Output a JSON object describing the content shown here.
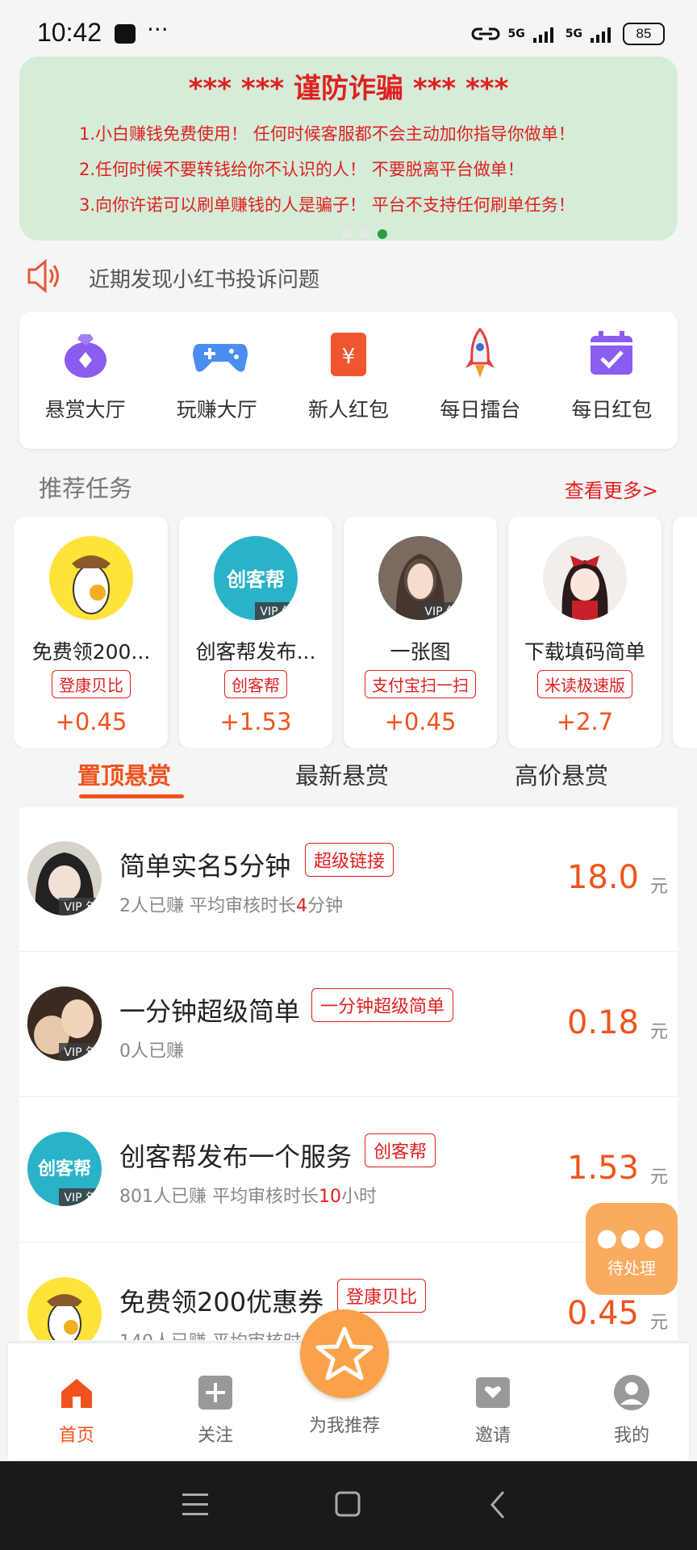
{
  "status_bar": {
    "time": "10:42",
    "more": "···",
    "net1": "5G",
    "net2": "5G",
    "battery": "85"
  },
  "banner": {
    "title": "***  ***  谨防诈骗  ***  ***",
    "lines": [
      "1.小白赚钱免费使用！ 任何时候客服都不会主动加你指导你做单！",
      "2.任何时候不要转钱给你不认识的人！ 不要脱离平台做单！",
      "3.向你许诺可以刷单赚钱的人是骗子！ 平台不支持任何刷单任务！"
    ]
  },
  "notice": {
    "text": "近期发现小红书投诉问题"
  },
  "quick_menu": [
    {
      "label": "悬赏大厅",
      "icon": "money-bag-icon",
      "color": "#8a5cf0"
    },
    {
      "label": "玩赚大厅",
      "icon": "gamepad-icon",
      "color": "#4a8ef0"
    },
    {
      "label": "新人红包",
      "icon": "red-envelope-icon",
      "color": "#f05530"
    },
    {
      "label": "每日擂台",
      "icon": "rocket-icon",
      "color": "#e04040"
    },
    {
      "label": "每日红包",
      "icon": "calendar-check-icon",
      "color": "#8a5cf0"
    }
  ],
  "recommend": {
    "title": "推荐任务",
    "see_more": "查看更多>",
    "cards": [
      {
        "title": "免费领200...",
        "tag": "登康贝比",
        "value": "+0.45",
        "vip": ""
      },
      {
        "title": "创客帮发布...",
        "tag": "创客帮",
        "value": "+1.53",
        "vip": "VIP 年",
        "avatar_text": "创客帮"
      },
      {
        "title": "一张图",
        "tag": "支付宝扫一扫",
        "value": "+0.45",
        "vip": "VIP 年"
      },
      {
        "title": "下载填码简单",
        "tag": "米读极速版",
        "value": "+2.7",
        "vip": ""
      }
    ]
  },
  "tabs": [
    "置顶悬赏",
    "最新悬赏",
    "高价悬赏"
  ],
  "list": [
    {
      "title": "简单实名5分钟",
      "tag": "超级链接",
      "sub_pre": "2人已赚  平均审核时长",
      "sub_num": "4",
      "sub_post": "分钟",
      "value": "18.0",
      "unit": "元",
      "vip": "VIP 年"
    },
    {
      "title": "一分钟超级简单",
      "tag": "一分钟超级简单",
      "sub_pre": "0人已赚",
      "sub_num": "",
      "sub_post": "",
      "value": "0.18",
      "unit": "元",
      "vip": "VIP 年"
    },
    {
      "title": "创客帮发布一个服务",
      "tag": "创客帮",
      "sub_pre": "801人已赚  平均审核时长",
      "sub_num": "10",
      "sub_post": "小时",
      "value": "1.53",
      "unit": "元",
      "vip": "VIP 年",
      "avatar_text": "创客帮"
    },
    {
      "title": "免费领200优惠券",
      "tag": "登康贝比",
      "sub_pre": "140人已赚  平均审核时",
      "sub_num": "",
      "sub_post": "",
      "value": "0.45",
      "unit": "元",
      "vip": ""
    }
  ],
  "pending": {
    "label": "待处理"
  },
  "bottom_nav": {
    "home": "首页",
    "follow": "关注",
    "recommend": "为我推荐",
    "invite": "邀请",
    "mine": "我的"
  }
}
